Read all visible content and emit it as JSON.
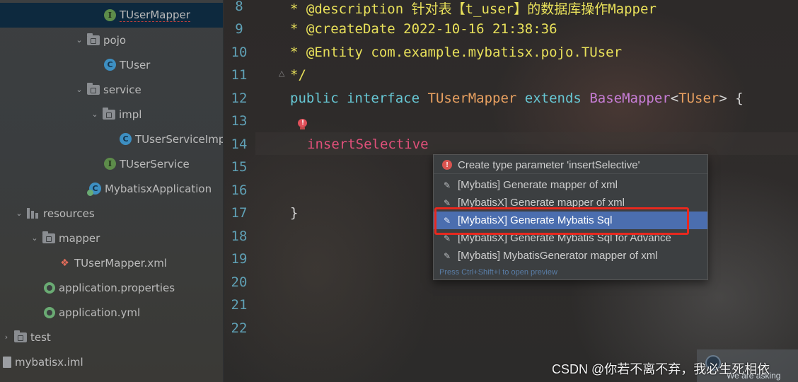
{
  "project_tree": {
    "items": [
      {
        "label": "TUserMapper",
        "icon": "interface-icon"
      },
      {
        "label": "pojo",
        "icon": "package-icon"
      },
      {
        "label": "TUser",
        "icon": "class-icon"
      },
      {
        "label": "service",
        "icon": "package-icon"
      },
      {
        "label": "impl",
        "icon": "package-icon"
      },
      {
        "label": "TUserServiceImp",
        "icon": "class-icon"
      },
      {
        "label": "TUserService",
        "icon": "interface-icon"
      },
      {
        "label": "MybatisxApplication",
        "icon": "spring-class-icon"
      },
      {
        "label": "resources",
        "icon": "resources-folder-icon"
      },
      {
        "label": "mapper",
        "icon": "folder-icon"
      },
      {
        "label": "TUserMapper.xml",
        "icon": "mybatis-xml-icon"
      },
      {
        "label": "application.properties",
        "icon": "spring-config-icon"
      },
      {
        "label": "application.yml",
        "icon": "spring-config-icon"
      },
      {
        "label": "test",
        "icon": "folder-icon"
      },
      {
        "label": "mybatisx.iml",
        "icon": "iml-file-icon"
      }
    ]
  },
  "editor": {
    "line_numbers": [
      "8",
      "9",
      "10",
      "11",
      "12",
      "13",
      "14",
      "15",
      "16",
      "17",
      "18",
      "19",
      "20",
      "21",
      "22"
    ],
    "lines": {
      "l8_star": "* ",
      "l8_tag": "@description",
      "l8_text": " 针对表【t_user】的数据库操作Mapper",
      "l9_star": "* ",
      "l9_tag": "@createDate",
      "l9_text": " 2022-10-16 21:38:36",
      "l10_star": "* ",
      "l10_tag": "@Entity",
      "l10_text": " com.example.mybatisx.pojo.TUser",
      "l11": "*/",
      "l12_kw1": "public",
      "l12_kw2": "interface",
      "l12_name": "TUserMapper",
      "l12_kw3": "extends",
      "l12_super": "BaseMapper",
      "l12_lt": "<",
      "l12_generic": "TUser",
      "l12_gt": "> {",
      "l14": "insertSelective",
      "l17": "}"
    }
  },
  "popup": {
    "items": [
      {
        "label": "Create type parameter 'insertSelective'",
        "icon": "error-bulb-icon"
      },
      {
        "label": "[Mybatis] Generate mapper of xml",
        "icon": "edit-icon"
      },
      {
        "label": "[MybatisX] Generate mapper of xml",
        "icon": "edit-icon"
      },
      {
        "label": "[MybatisX] Generate Mybatis Sql",
        "icon": "edit-icon"
      },
      {
        "label": "[MybatisX] Generate Mybatis Sql for Advance",
        "icon": "edit-icon"
      },
      {
        "label": "[Mybatis] MybatisGenerator mapper of xml",
        "icon": "edit-icon"
      }
    ],
    "selected_index": 3,
    "hint": "Press Ctrl+Shift+I to open preview"
  },
  "watermark": "CSDN @你若不离不弃，我必生死相依",
  "toast": {
    "text": "We are asking"
  },
  "colors": {
    "selection": "#4b6eaf",
    "highlight_box": "#e8281e",
    "comment": "#e8e05a",
    "keyword": "#67c7d4"
  }
}
